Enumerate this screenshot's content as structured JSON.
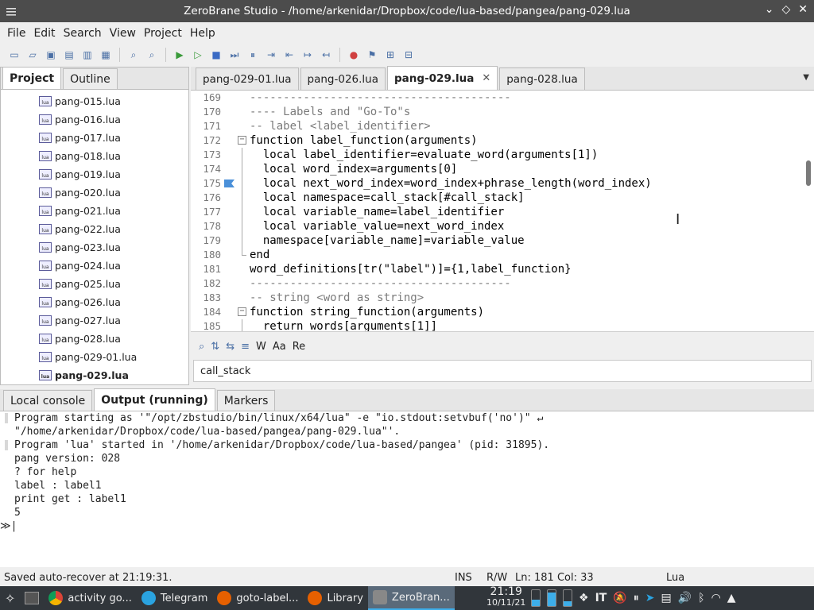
{
  "window": {
    "title": "ZeroBrane Studio - /home/arkenidar/Dropbox/code/lua-based/pangea/pang-029.lua"
  },
  "menu": [
    "File",
    "Edit",
    "Search",
    "View",
    "Project",
    "Help"
  ],
  "left_panel": {
    "tabs": [
      "Project",
      "Outline"
    ],
    "icon_label": "lua",
    "files": [
      "pang-015.lua",
      "pang-016.lua",
      "pang-017.lua",
      "pang-018.lua",
      "pang-019.lua",
      "pang-020.lua",
      "pang-021.lua",
      "pang-022.lua",
      "pang-023.lua",
      "pang-024.lua",
      "pang-025.lua",
      "pang-026.lua",
      "pang-027.lua",
      "pang-028.lua",
      "pang-029-01.lua",
      "pang-029.lua"
    ]
  },
  "editor_tabs": [
    "pang-029-01.lua",
    "pang-026.lua",
    "pang-029.lua",
    "pang-028.lua"
  ],
  "editor_tab_close": "✕",
  "editor": {
    "lines": [
      {
        "n": "169",
        "text": "---------------------------------------"
      },
      {
        "n": "170",
        "text": "---- Labels and \"Go-To\"s"
      },
      {
        "n": "171",
        "text": "-- label <label_identifier>"
      },
      {
        "n": "172",
        "text": "function label_function(arguments)"
      },
      {
        "n": "173",
        "text": "  local label_identifier=evaluate_word(arguments[1])"
      },
      {
        "n": "174",
        "text": "  local word_index=arguments[0]"
      },
      {
        "n": "175",
        "text": "  local next_word_index=word_index+phrase_length(word_index)"
      },
      {
        "n": "176",
        "text": "  local namespace=call_stack[#call_stack]"
      },
      {
        "n": "177",
        "text": "  local variable_name=label_identifier"
      },
      {
        "n": "178",
        "text": "  local variable_value=next_word_index"
      },
      {
        "n": "179",
        "text": "  namespace[variable_name]=variable_value"
      },
      {
        "n": "180",
        "text": "end"
      },
      {
        "n": "181",
        "text": "word_definitions[tr(\"label\")]={1,label_function}"
      },
      {
        "n": "182",
        "text": "---------------------------------------"
      },
      {
        "n": "183",
        "text": "-- string <word as string>"
      },
      {
        "n": "184",
        "text": "function string_function(arguments)"
      },
      {
        "n": "185",
        "text": "  return words[arguments[1]]"
      }
    ]
  },
  "find": {
    "options": [
      "W",
      "Aa",
      "Re"
    ],
    "value": "call_stack"
  },
  "bottom_tabs": [
    "Local console",
    "Output (running)",
    "Markers"
  ],
  "console": {
    "lines": [
      "Program starting as '\"/opt/zbstudio/bin/linux/x64/lua\" -e \"io.stdout:setvbuf('no')\" ↵",
      "\"/home/arkenidar/Dropbox/code/lua-based/pangea/pang-029.lua\"'.",
      "Program 'lua' started in '/home/arkenidar/Dropbox/code/lua-based/pangea' (pid: 31895).",
      "pang version: 028",
      "? for help",
      "label : label1",
      "print get : label1",
      "5"
    ],
    "prompt": "≫|"
  },
  "status": {
    "message": "Saved auto-recover at 21:19:31.",
    "mode": "INS",
    "access": "R/W",
    "position": "Ln: 181 Col: 33",
    "language": "Lua"
  },
  "taskbar": {
    "items": [
      "activity go...",
      "Telegram",
      "goto-label...",
      "Library",
      "ZeroBran..."
    ],
    "time": "21:19",
    "date": "10/11/21",
    "tray_layout": "IT"
  },
  "colors": {
    "titlebar": "#4c4c4c",
    "taskbar": "#31363b",
    "accent": "#3daee9"
  }
}
